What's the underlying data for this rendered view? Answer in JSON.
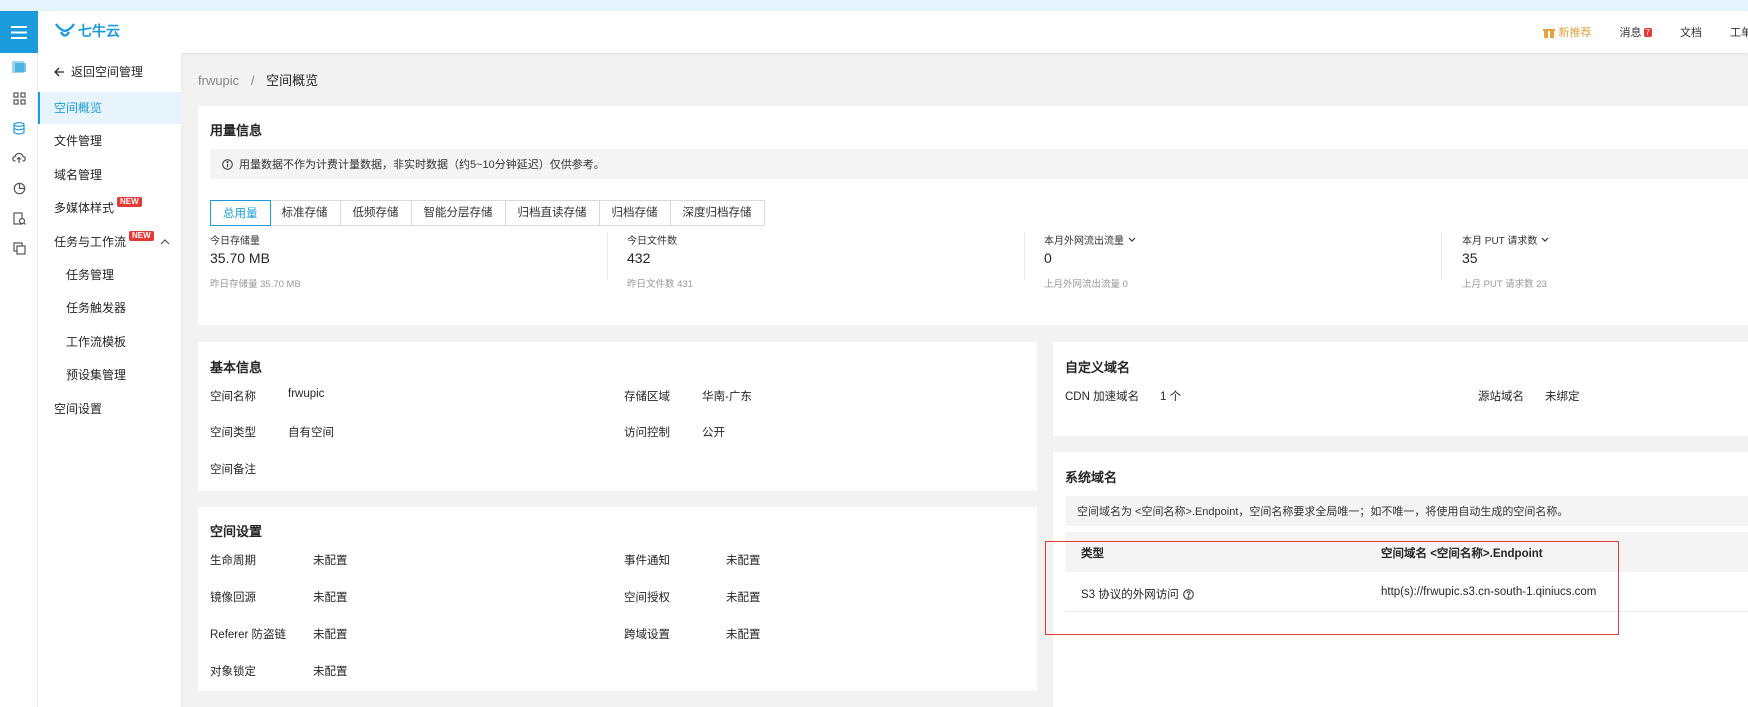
{
  "header": {
    "logo_text": "七牛云",
    "new_recommend": "新推荐",
    "messages": "消息",
    "messages_badge": "7",
    "docs": "文档",
    "workorder": "工单"
  },
  "sidebar": {
    "back_label": "返回空间管理",
    "items": [
      {
        "label": "空间概览",
        "active": true
      },
      {
        "label": "文件管理"
      },
      {
        "label": "域名管理"
      },
      {
        "label": "多媒体样式",
        "tag": "NEW"
      },
      {
        "label": "任务与工作流",
        "tag": "NEW"
      },
      {
        "label": "任务管理"
      },
      {
        "label": "任务触发器"
      },
      {
        "label": "工作流模板"
      },
      {
        "label": "预设集管理"
      },
      {
        "label": "空间设置"
      }
    ]
  },
  "breadcrumb": {
    "bucket": "frwupic",
    "separator": "/",
    "current": "空间概览"
  },
  "usage": {
    "title": "用量信息",
    "notice": "用量数据不作为计费计量数据，非实时数据（约5~10分钟延迟）仅供参考。",
    "tabs": [
      "总用量",
      "标准存储",
      "低频存储",
      "智能分层存储",
      "归档直读存储",
      "归档存储",
      "深度归档存储"
    ],
    "stats": [
      {
        "label": "今日存储量",
        "value": "35.70 MB",
        "prev": "昨日存储量 35.70 MB"
      },
      {
        "label": "今日文件数",
        "value": "432",
        "prev": "昨日文件数 431"
      },
      {
        "label": "本月外网流出流量",
        "value": "0",
        "prev": "上月外网流出流量 0"
      },
      {
        "label": "本月 PUT 请求数",
        "value": "35",
        "prev": "上月 PUT 请求数 23"
      }
    ]
  },
  "basic": {
    "title": "基本信息",
    "name_label": "空间名称",
    "name_value": "frwupic",
    "region_label": "存储区域",
    "region_value": "华南-广东",
    "type_label": "空间类型",
    "type_value": "自有空间",
    "access_label": "访问控制",
    "access_value": "公开",
    "remark_label": "空间备注"
  },
  "settings": {
    "title": "空间设置",
    "lifecycle_label": "生命周期",
    "lifecycle_value": "未配置",
    "event_label": "事件通知",
    "event_value": "未配置",
    "mirror_label": "镜像回源",
    "mirror_value": "未配置",
    "auth_label": "空间授权",
    "auth_value": "未配置",
    "referer_label": "Referer 防盗链",
    "referer_value": "未配置",
    "cors_label": "跨域设置",
    "cors_value": "未配置",
    "lock_label": "对象锁定",
    "lock_value": "未配置"
  },
  "custom_domain": {
    "title": "自定义域名",
    "cdn_label": "CDN 加速域名",
    "cdn_value": "1 个",
    "origin_label": "源站域名",
    "origin_value": "未绑定"
  },
  "system_domain": {
    "title": "系统域名",
    "notice": "空间域名为 <空间名称>.Endpoint，空间名称要求全局唯一；如不唯一，将使用自动生成的空间名称。",
    "col_type": "类型",
    "col_domain": "空间域名 <空间名称>.Endpoint",
    "row_type": "S3 协议的外网访问",
    "row_domain": "http(s)://frwupic.s3.cn-south-1.qiniucs.com"
  },
  "colors": {
    "accent": "#1a9cdc",
    "highlight_box": "#e53935"
  }
}
